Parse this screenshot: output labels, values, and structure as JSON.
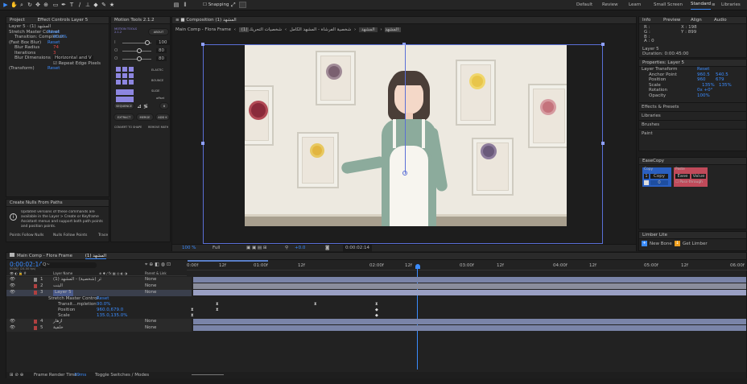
{
  "topbar": {
    "workspaces": [
      "Default",
      "Review",
      "Learn",
      "Small Screen",
      "Standard",
      "Libraries"
    ],
    "snapping": "Snapping"
  },
  "project_panel": {
    "tabs": [
      "Project",
      "Effect Controls Layer 5"
    ],
    "layer_title": "Layer 5 · (1) المشهد",
    "effects": [
      {
        "name": "Stretch Master Control",
        "value": "Reset"
      },
      {
        "name": "Transition: Completion",
        "value": "90.0%"
      },
      {
        "name": "(Fast Box Blur)",
        "value": "Reset"
      },
      {
        "name": "Blur Radius",
        "value": "74"
      },
      {
        "name": "Iterations",
        "value": "3"
      },
      {
        "name": "Blur Dimensions",
        "value": "Horizontal and V"
      },
      {
        "name": "",
        "value": "Repeat Edge Pixels"
      },
      {
        "name": "(Transform)",
        "value": "Reset"
      }
    ]
  },
  "create_nulls": {
    "title": "Create Nulls From Paths",
    "message": "Updated versions of these commands are available in the Layer > Create or Keyframe Assistant menus and support both path points and position points.",
    "buttons": [
      "Points Follow Nulls",
      "Nulls Follow Points",
      "Trace"
    ]
  },
  "motion_tools": {
    "title": "Motion Tools 2.1.2",
    "subtitle": "MOTION TOOLS 2.1.2",
    "about": "ABOUT",
    "sliders": [
      {
        "label": "I",
        "value": "100"
      },
      {
        "label": "O",
        "value": "80"
      },
      {
        "label": "O",
        "value": "80"
      }
    ],
    "buttons": {
      "elastic": "ELASTIC",
      "bounce": "BOUNCE",
      "slide": "SLIDE",
      "offset": "offset",
      "sequence": "SEQUENCE",
      "extract": "EXTRACT",
      "merge": "MERGE",
      "add": "ADD K",
      "convert": "CONVERT TO SHAPE",
      "remove": "REMOVE MATH"
    }
  },
  "composition": {
    "tab": "Composition (1) المشهد",
    "breadcrumbs": [
      "Main Comp - Flora Frame",
      "(1) المشهد",
      "المشهد",
      "شخصية الفرشاة - المشهد الكامل",
      "شخصيات التحريك"
    ],
    "footer": {
      "zoom": "100 %",
      "quality": "Full",
      "exposure": "+0.0",
      "timecode": "0:00:02:14"
    }
  },
  "info_panel": {
    "tabs": [
      "Info",
      "Preview",
      "Align",
      "Audio"
    ],
    "rgb": [
      "R :",
      "G :",
      "B :",
      "A : 0"
    ],
    "coords": [
      "X : 198",
      "Y : 899"
    ],
    "layer_info": [
      "Layer 5",
      "Duration: 0:00:45:00"
    ]
  },
  "properties": {
    "title": "Properties: Layer 5",
    "section": "Layer Transform",
    "reset": "Reset",
    "rows": [
      {
        "name": "Anchor Point",
        "v1": "960.5",
        "v2": "540.5"
      },
      {
        "name": "Position",
        "v1": "960",
        "v2": "679"
      },
      {
        "name": "Scale",
        "v1": "135%",
        "v2": "135%"
      },
      {
        "name": "Rotation",
        "v1": "0x +0°",
        "v2": ""
      },
      {
        "name": "Opacity",
        "v1": "100%",
        "v2": ""
      }
    ],
    "collapsed": [
      "Effects & Presets",
      "Libraries",
      "Brushes",
      "Paint"
    ]
  },
  "easecopy": {
    "title": "EaseCopy",
    "copy_label": "Copy",
    "copy_btn": "Copy",
    "slot": "0",
    "paste_label": "Paste",
    "ease_btn": "Ease",
    "value_btn": "Value",
    "passthrough": "Pass-through"
  },
  "limber": {
    "title": "Limber Lite",
    "new_bone": "New Bone",
    "get_limber": "Get Limber"
  },
  "timeline": {
    "tab": "Main Comp - Flora Frame",
    "tab2": "(1) المشهد",
    "timecode": "0:00:02:14",
    "subcode": "00062 (24.00 fps)",
    "search_placeholder": "Q~",
    "columns": {
      "layer": "Layer Name",
      "parent": "Parent & Link"
    },
    "layers": [
      {
        "num": "1",
        "name": "الدوائر (شخصية) - المشهد (1)",
        "parent": "None"
      },
      {
        "num": "2",
        "name": "البنت",
        "parent": "None"
      },
      {
        "num": "3",
        "name": "Layer 5",
        "parent": "None"
      },
      {
        "num": "",
        "name": "Stretch Master Control",
        "parent": "Reset"
      },
      {
        "num": "",
        "name": "Transit...mpletion",
        "parent": "90.0%"
      },
      {
        "num": "",
        "name": "Position",
        "parent": "960.0,679.0"
      },
      {
        "num": "",
        "name": "Scale",
        "parent": "135.0,135.0%"
      },
      {
        "num": "4",
        "name": "أزهار",
        "parent": "None"
      },
      {
        "num": "5",
        "name": "خلفية",
        "parent": "None"
      }
    ],
    "ruler": [
      "0:00f",
      "12f",
      "01:00f",
      "12f",
      "02:00f",
      "12f",
      "03:00f",
      "12f",
      "04:00f",
      "12f",
      "05:00f",
      "12f",
      "06:00f"
    ],
    "footer": [
      "Frame Render Time",
      "39ms",
      "Toggle Switches / Modes"
    ]
  },
  "colors": {
    "accent": "#3b8cff",
    "selection": "#2d8cf0",
    "easecopy": "#c04a5a"
  }
}
